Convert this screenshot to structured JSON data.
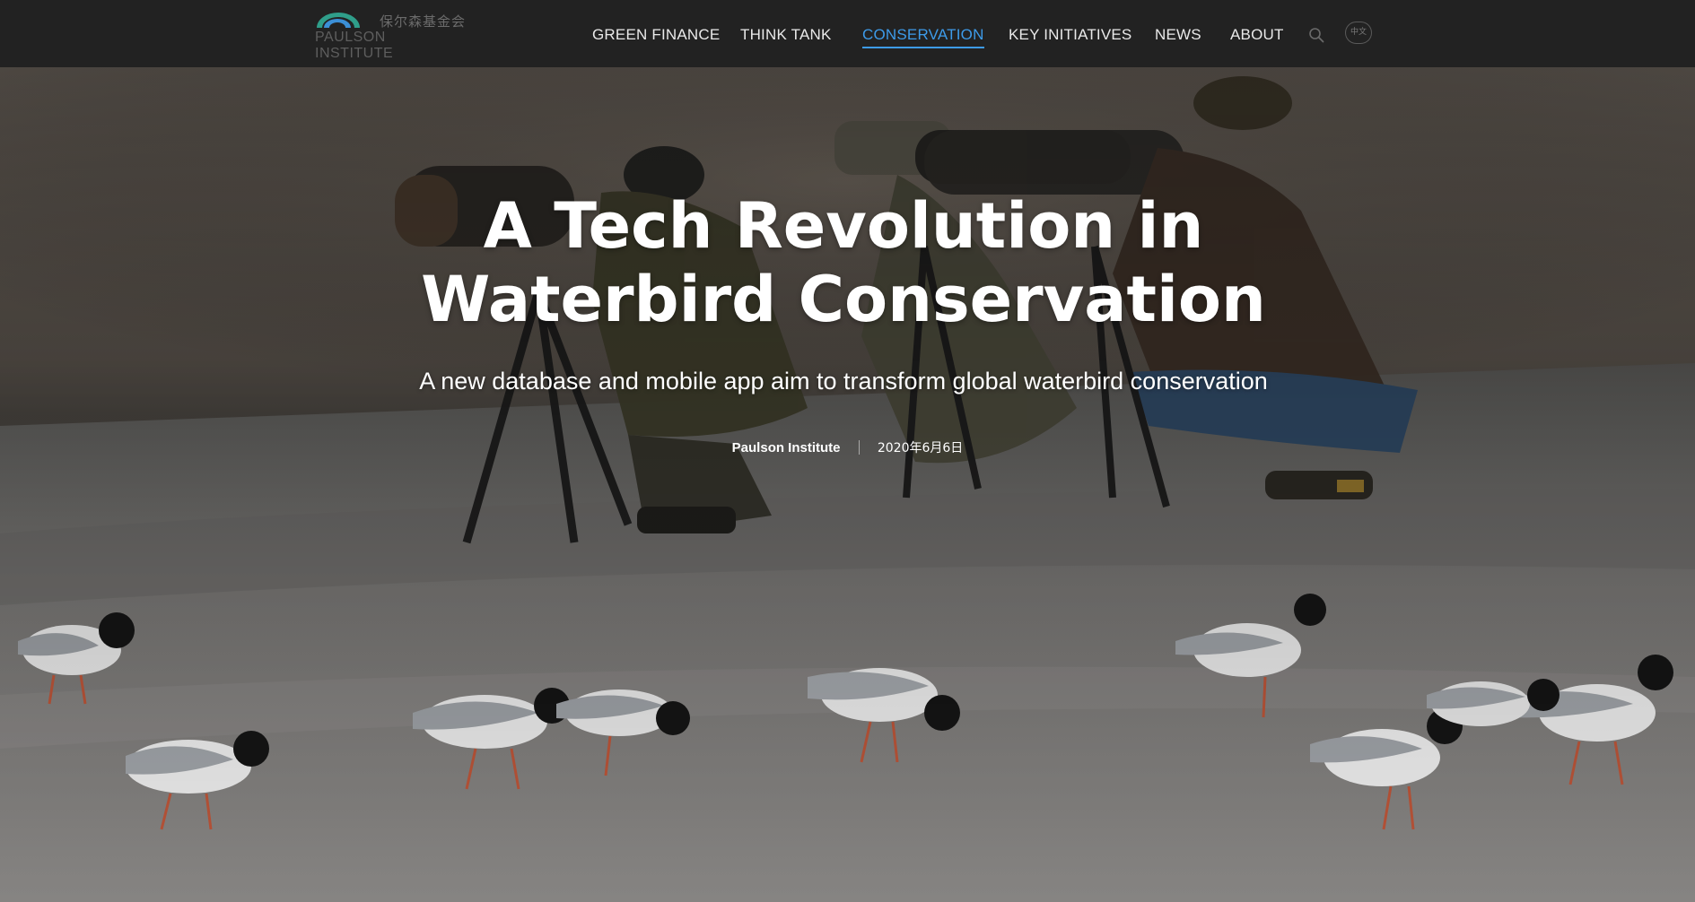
{
  "header": {
    "logo": {
      "cn_text": "保尔森基金会",
      "en_text": "PAULSON INSTITUTE",
      "colors": {
        "arc_outer": "#2f9e8a",
        "arc_inner": "#3b8fd6"
      }
    },
    "nav": [
      {
        "label": "GREEN FINANCE",
        "active": false
      },
      {
        "label": "THINK TANK",
        "active": false
      },
      {
        "label": "CONSERVATION",
        "active": true
      },
      {
        "label": "KEY INITIATIVES",
        "active": false
      },
      {
        "label": "NEWS",
        "active": false
      },
      {
        "label": "ABOUT",
        "active": false
      }
    ],
    "search_icon": "search-icon",
    "language_toggle": "中文",
    "accent_color": "#3d9be9"
  },
  "hero": {
    "title": "A Tech Revolution in Waterbird Conservation",
    "subtitle": "A new database and mobile app aim to transform global waterbird conservation",
    "author": "Paulson Institute",
    "date": "2020年6月6日",
    "image_subject": "photographers with telephoto lenses on tripods and black-headed gulls on wet mudflat"
  }
}
